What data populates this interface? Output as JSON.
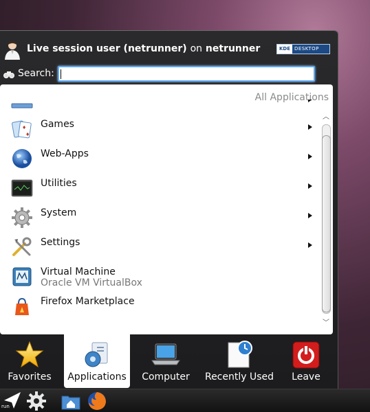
{
  "header": {
    "user_name": "Live session user (netrunner)",
    "on_text": "on",
    "host": "netrunner",
    "badge_left": "KDE",
    "badge_right": "DESKTOP"
  },
  "search": {
    "label": "Search:",
    "value": ""
  },
  "panel": {
    "all_apps_label": "All Applications",
    "items": [
      {
        "label": "",
        "sub": "",
        "icon": "office-icon",
        "submenu": true
      },
      {
        "label": "Games",
        "sub": "",
        "icon": "games-cards-icon",
        "submenu": true
      },
      {
        "label": "Web-Apps",
        "sub": "",
        "icon": "globe-icon",
        "submenu": true
      },
      {
        "label": "Utilities",
        "sub": "",
        "icon": "terminal-icon",
        "submenu": true
      },
      {
        "label": "System",
        "sub": "",
        "icon": "gear-icon",
        "submenu": true
      },
      {
        "label": "Settings",
        "sub": "",
        "icon": "tools-icon",
        "submenu": true
      },
      {
        "label": "Virtual Machine",
        "sub": "Oracle VM VirtualBox",
        "icon": "virtualbox-icon",
        "submenu": false
      },
      {
        "label": "Firefox Marketplace",
        "sub": "",
        "icon": "marketplace-bag-icon",
        "submenu": false
      }
    ]
  },
  "tabs": [
    {
      "label": "Favorites",
      "icon": "star-icon",
      "active": false
    },
    {
      "label": "Applications",
      "icon": "applications-icon",
      "active": true
    },
    {
      "label": "Computer",
      "icon": "laptop-icon",
      "active": false
    },
    {
      "label": "Recently Used",
      "icon": "clock-document-icon",
      "active": false
    },
    {
      "label": "Leave",
      "icon": "power-icon",
      "active": false
    }
  ],
  "taskbar": {
    "run_label": "run",
    "items": [
      "run-arrow-icon",
      "settings-gear-icon",
      "home-folder-icon",
      "firefox-icon"
    ]
  },
  "colors": {
    "accent_focus": "#5fa8ef",
    "panel_bg": "#ffffff",
    "launcher_bg": "#1c1c1e"
  }
}
